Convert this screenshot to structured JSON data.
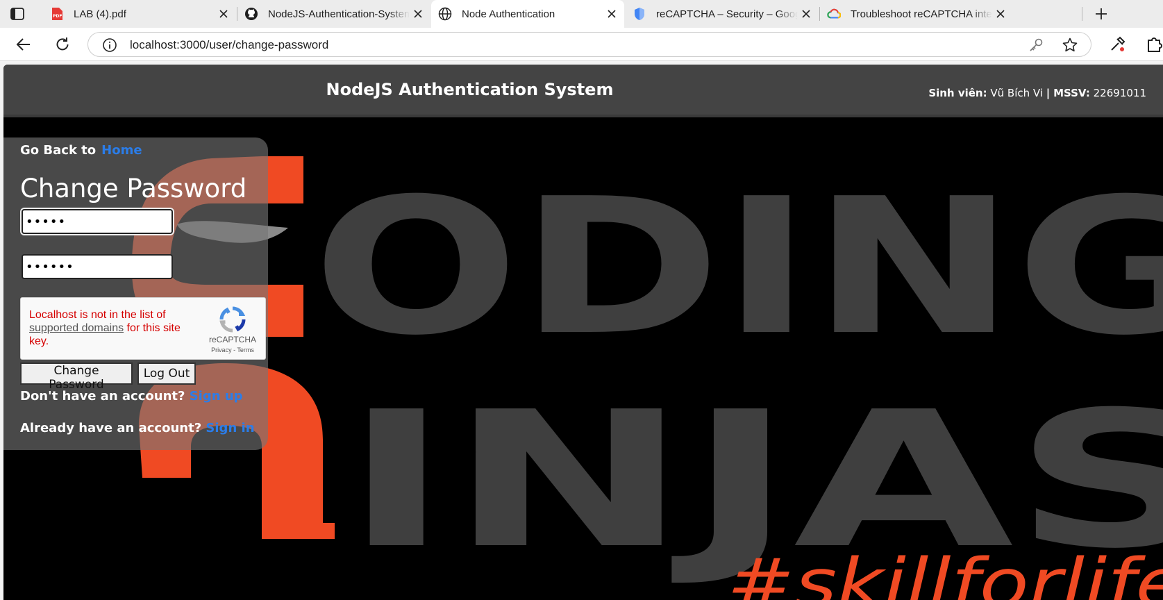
{
  "browser": {
    "tabs": [
      {
        "title": "LAB (4).pdf",
        "icon": "pdf-icon",
        "active": false
      },
      {
        "title": "NodeJS-Authentication-System/p",
        "icon": "github-icon",
        "active": false
      },
      {
        "title": "Node Authentication",
        "icon": "globe-icon",
        "active": true
      },
      {
        "title": "reCAPTCHA – Security – Google C",
        "icon": "shield-icon",
        "active": false
      },
      {
        "title": "Troubleshoot reCAPTCHA integrat",
        "icon": "google-cloud-icon",
        "active": false
      }
    ],
    "url": "localhost:3000/user/change-password"
  },
  "header": {
    "title": "NodeJS Authentication System",
    "student_label": "Sinh viên:",
    "student_name": "Vũ Bích Vi",
    "separator": "|",
    "id_label": "MSSV:",
    "id_value": "22691011"
  },
  "background": {
    "line1": "ODING",
    "line2": "INJAS",
    "tagline": "#skillforlife",
    "colors": {
      "brand_orange": "#f04a23",
      "letters_gray": "#3f3f3f",
      "background": "#000000"
    }
  },
  "form": {
    "goback_text": "Go Back to",
    "home_link": "Home",
    "heading": "Change Password",
    "password1_value": "•••••",
    "password2_value": "••••••",
    "recaptcha": {
      "error_prefix": "Localhost is not in the list of",
      "error_link": "supported domains",
      "error_suffix": " for this site key.",
      "brand": "reCAPTCHA",
      "privacy": "Privacy",
      "dot": " - ",
      "terms": "Terms"
    },
    "change_button": "Change Password",
    "logout_button": "Log Out",
    "signup_prompt": "Don't have an account?",
    "signup_link": "Sign up",
    "signin_prompt": "Already have an account?",
    "signin_link": "Sign in"
  }
}
